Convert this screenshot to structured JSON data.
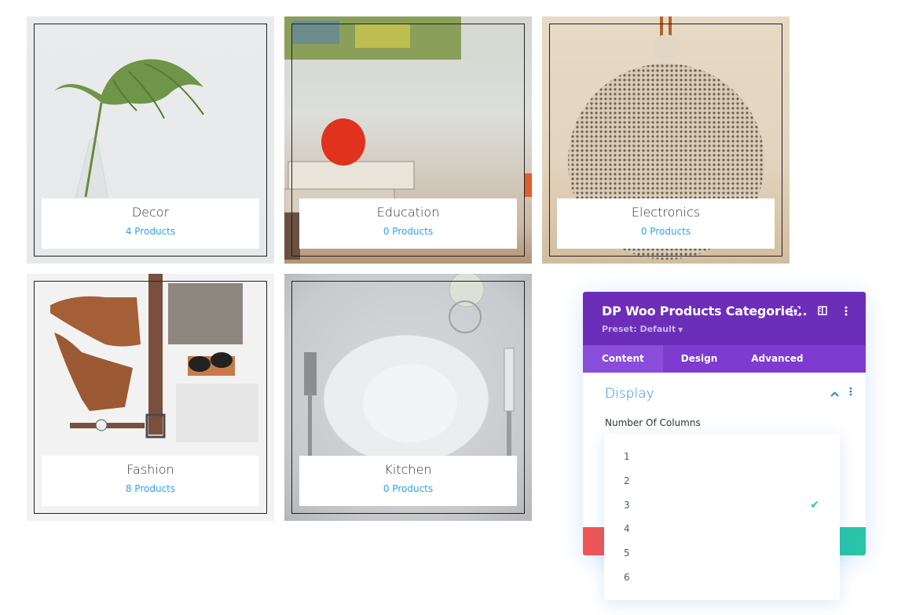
{
  "categories": [
    {
      "name": "Decor",
      "count": "4 Products",
      "image": "monstera-leaf-in-vase"
    },
    {
      "name": "Education",
      "count": "0 Products",
      "image": "apple-on-books"
    },
    {
      "name": "Electronics",
      "count": "0 Products",
      "image": "round-speaker"
    },
    {
      "name": "Fashion",
      "count": "8 Products",
      "image": "boots-belt-clothes-flatlay"
    },
    {
      "name": "Kitchen",
      "count": "0 Products",
      "image": "plate-fork-knife"
    }
  ],
  "panel": {
    "title": "DP Woo Products Categorie...",
    "preset": "Preset: Default",
    "header_icons": [
      "focus-icon",
      "split-view-icon",
      "more-vertical-icon"
    ],
    "tabs": [
      {
        "label": "Content",
        "active": true
      },
      {
        "label": "Design",
        "active": false
      },
      {
        "label": "Advanced",
        "active": false
      }
    ],
    "section": {
      "title": "Display",
      "expanded": true
    },
    "field": {
      "label": "Number Of Columns",
      "selected": "3"
    },
    "colors": {
      "header": "#6c2eb9",
      "tabs": "#7d3bd0",
      "accent": "#2b87da",
      "cancel": "#ef5555",
      "save": "#29c4a9"
    }
  },
  "dropdown": {
    "options": [
      "1",
      "2",
      "3",
      "4",
      "5",
      "6"
    ],
    "selected": "3"
  }
}
